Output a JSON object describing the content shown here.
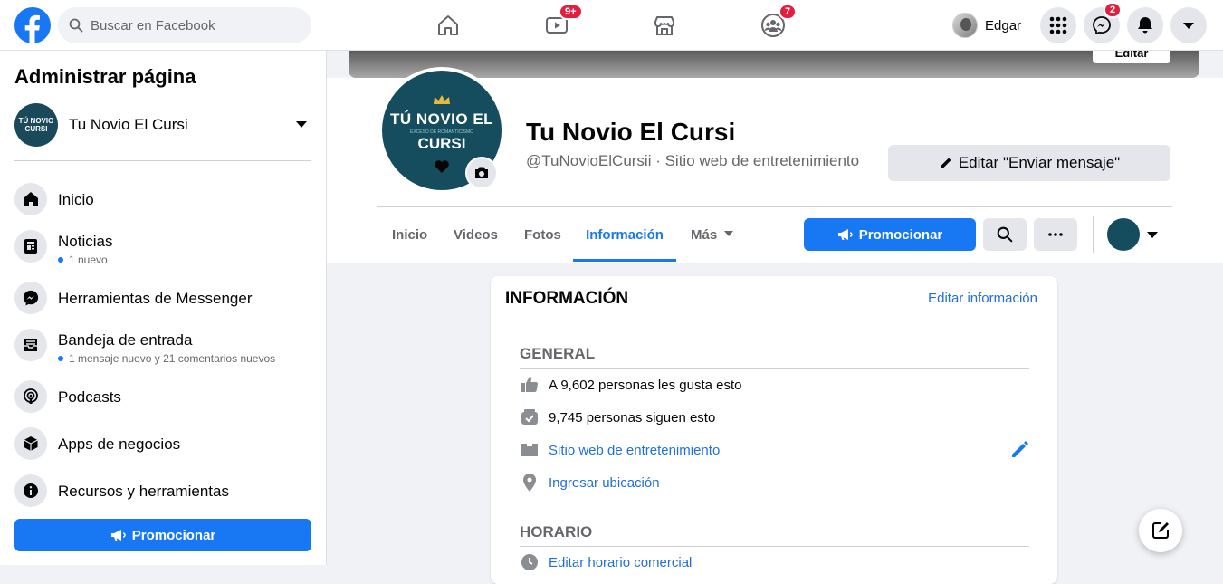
{
  "search": {
    "placeholder": "Buscar en Facebook"
  },
  "nav": {
    "watch_badge": "9+",
    "groups_badge": "7",
    "messenger_badge": "2"
  },
  "profile": {
    "name": "Edgar"
  },
  "sidebar": {
    "title": "Administrar página",
    "page_name": "Tu Novio El Cursi",
    "items": [
      {
        "label": "Inicio",
        "sub": ""
      },
      {
        "label": "Noticias",
        "sub": "1 nuevo"
      },
      {
        "label": "Herramientas de Messenger",
        "sub": ""
      },
      {
        "label": "Bandeja de entrada",
        "sub": "1 mensaje nuevo y 21 comentarios nuevos"
      },
      {
        "label": "Podcasts",
        "sub": ""
      },
      {
        "label": "Apps de negocios",
        "sub": ""
      },
      {
        "label": "Recursos y herramientas",
        "sub": ""
      }
    ],
    "promote_label": "Promocionar"
  },
  "cover": {
    "edit_label": "Editar"
  },
  "page": {
    "name": "Tu Novio El Cursi",
    "handle": "@TuNovioElCursii · Sitio web de entretenimiento",
    "avatar_text_line1": "TÚ NOVIO EL",
    "avatar_text_line2": "EXCESO DE ROMANTICISMO",
    "avatar_text_line3": "CURSI",
    "edit_message_label": "Editar \"Enviar mensaje\""
  },
  "tabs": [
    {
      "label": "Inicio"
    },
    {
      "label": "Videos"
    },
    {
      "label": "Fotos"
    },
    {
      "label": "Información"
    },
    {
      "label": "Más"
    }
  ],
  "actions": {
    "promote_label": "Promocionar"
  },
  "info": {
    "title": "INFORMACIÓN",
    "edit_label": "Editar información",
    "general_heading": "GENERAL",
    "likes": "A 9,602 personas les gusta esto",
    "followers": "9,745 personas siguen esto",
    "category": "Sitio web de entretenimiento",
    "location": "Ingresar ubicación",
    "hours_heading": "HORARIO",
    "hours_edit": "Editar horario comercial"
  },
  "colors": {
    "brand": "#1877f2",
    "badge": "#e41e3f",
    "page_avatar_bg": "#154d5e"
  }
}
